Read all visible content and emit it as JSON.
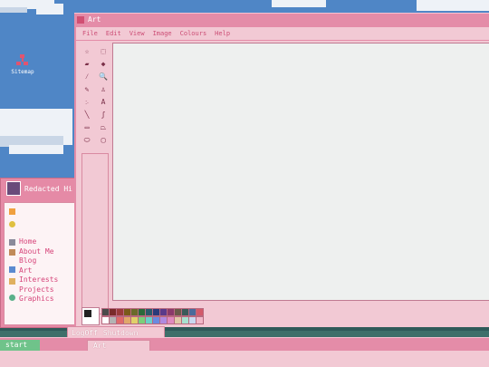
{
  "desktop": {
    "sitemap_label": "Sitemap"
  },
  "side_window": {
    "title": "Redacted Hi",
    "links": [
      "Home",
      "About Me",
      "Blog",
      "Art",
      "Interests",
      "Projects",
      "Graphics"
    ]
  },
  "art_window": {
    "title": "Art",
    "menu": [
      "File",
      "Edit",
      "View",
      "Image",
      "Colours",
      "Help"
    ],
    "tools": [
      {
        "name": "free-select-icon",
        "glyph": "☆"
      },
      {
        "name": "rect-select-icon",
        "glyph": "⬚"
      },
      {
        "name": "eraser-icon",
        "glyph": "▰"
      },
      {
        "name": "fill-icon",
        "glyph": "◆"
      },
      {
        "name": "picker-icon",
        "glyph": "⁄"
      },
      {
        "name": "magnifier-icon",
        "glyph": "🔍"
      },
      {
        "name": "pencil-icon",
        "glyph": "✎"
      },
      {
        "name": "brush-icon",
        "glyph": "♙"
      },
      {
        "name": "airbrush-icon",
        "glyph": "჻"
      },
      {
        "name": "text-icon",
        "glyph": "A"
      },
      {
        "name": "line-icon",
        "glyph": "╲"
      },
      {
        "name": "curve-icon",
        "glyph": "ʃ"
      },
      {
        "name": "rectangle-icon",
        "glyph": "▭"
      },
      {
        "name": "polygon-icon",
        "glyph": "⏢"
      },
      {
        "name": "ellipse-icon",
        "glyph": "⬭"
      },
      {
        "name": "rounded-rect-icon",
        "glyph": "▢"
      }
    ],
    "palette_top": [
      "#4a4a4a",
      "#7a2a2a",
      "#9a3a3a",
      "#7a5a1a",
      "#6a6a2a",
      "#2a6a3a",
      "#2a5a6a",
      "#2a3a7a",
      "#5a3a8a",
      "#8a3a6a",
      "#6a5a4a",
      "#3a5a5a",
      "#4a6a9a",
      "#d25a6a"
    ],
    "palette_bottom": [
      "#ffffff",
      "#b3b3b3",
      "#e06a6a",
      "#e0a86a",
      "#e0d06a",
      "#7ad07a",
      "#6ad0c8",
      "#6a8ae0",
      "#b08ae0",
      "#e08ac0",
      "#e0c8a8",
      "#a8e0d0",
      "#c8d8f0",
      "#f0b8c8"
    ],
    "foreground_color": "#222222",
    "background_color": "#ffffff"
  },
  "quickbar": {
    "logoff_label": "LogOff",
    "shutdown_label": "Shutdown"
  },
  "taskbar": {
    "start_label": "start",
    "task_art_label": "Art"
  },
  "colors": {
    "accent_pink": "#e48ca8",
    "light_pink": "#f2c9d4",
    "link_pink": "#d6457a",
    "start_green": "#6fc38a",
    "sky_blue": "#4f86c6"
  }
}
